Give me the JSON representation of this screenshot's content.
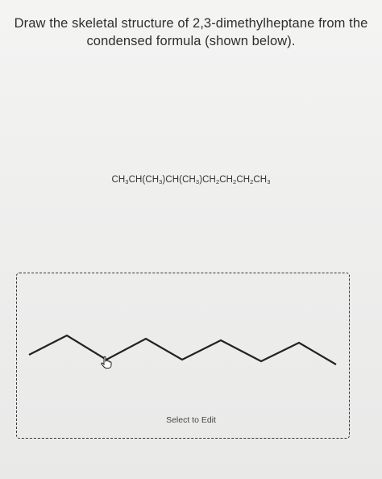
{
  "question": {
    "line1": "Draw the skeletal structure of 2,3-dimethylheptane from the",
    "line2": "condensed formula (shown below)."
  },
  "formula": {
    "parts": [
      "CH",
      "3",
      "CH(CH",
      "3",
      ")CH(CH",
      "3",
      ")CH",
      "2",
      "CH",
      "2",
      "CH",
      "2",
      "CH",
      "3"
    ]
  },
  "editor": {
    "select_label": "Select to Edit",
    "cursor_icon": "hand-pointer-icon"
  },
  "colors": {
    "text": "#2f2f2f",
    "stroke": "#222222",
    "border": "#3a3a3a"
  }
}
